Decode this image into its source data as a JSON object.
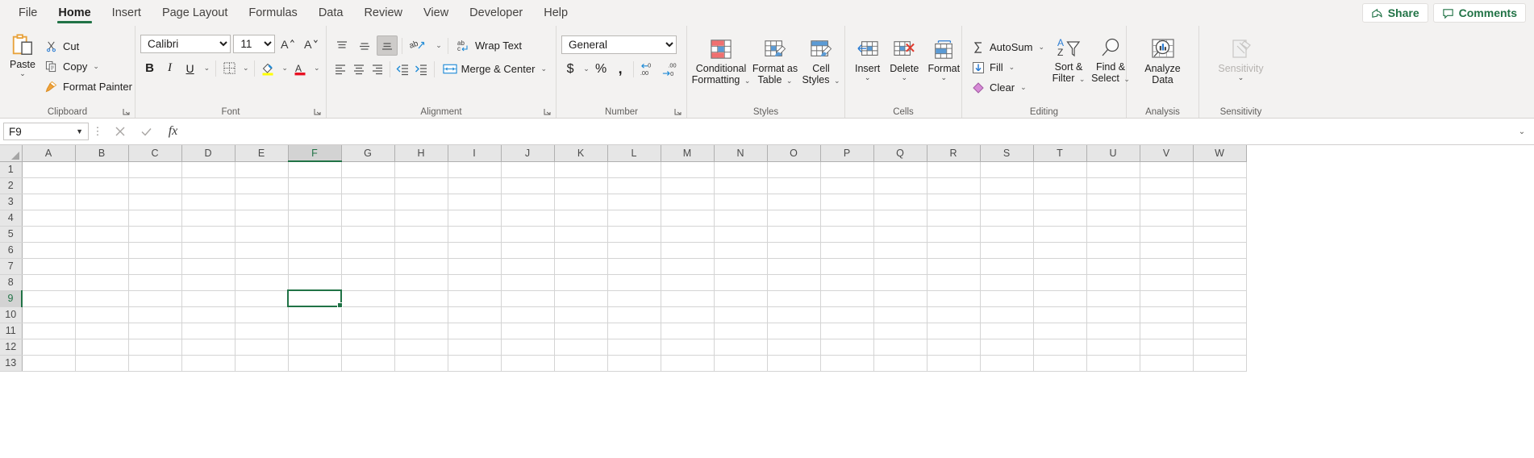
{
  "tabs": [
    {
      "label": "File",
      "active": false
    },
    {
      "label": "Home",
      "active": true
    },
    {
      "label": "Insert",
      "active": false
    },
    {
      "label": "Page Layout",
      "active": false
    },
    {
      "label": "Formulas",
      "active": false
    },
    {
      "label": "Data",
      "active": false
    },
    {
      "label": "Review",
      "active": false
    },
    {
      "label": "View",
      "active": false
    },
    {
      "label": "Developer",
      "active": false
    },
    {
      "label": "Help",
      "active": false
    }
  ],
  "titlebar": {
    "share_label": "Share",
    "comments_label": "Comments",
    "accent_color": "#217346"
  },
  "groups": {
    "clipboard": {
      "label": "Clipboard",
      "paste": "Paste",
      "cut": "Cut",
      "copy": "Copy",
      "format_painter": "Format Painter"
    },
    "font": {
      "label": "Font",
      "font_name": "Calibri",
      "font_size": "11",
      "grow_font": "A",
      "shrink_font": "A",
      "bold": "B",
      "italic": "I",
      "underline": "U",
      "borders": "borders",
      "fill_color": "fill",
      "font_color": "A"
    },
    "alignment": {
      "label": "Alignment",
      "align_top": "top-align",
      "align_middle": "middle-align",
      "align_bottom": "bottom-align",
      "orientation": "ab",
      "wrap_text": "Wrap Text",
      "align_left": "left-align",
      "align_center": "center-align",
      "align_right": "right-align",
      "decrease_indent": "decrease-indent",
      "increase_indent": "increase-indent",
      "merge_center": "Merge & Center"
    },
    "number": {
      "label": "Number",
      "format": "General",
      "currency": "$",
      "percent": "%",
      "comma": ",",
      "increase_decimal": ".00",
      "decrease_decimal": ".00"
    },
    "styles": {
      "label": "Styles",
      "conditional_formatting_l1": "Conditional",
      "conditional_formatting_l2": "Formatting",
      "format_as_table_l1": "Format as",
      "format_as_table_l2": "Table",
      "cell_styles_l1": "Cell",
      "cell_styles_l2": "Styles"
    },
    "cells": {
      "label": "Cells",
      "insert": "Insert",
      "delete": "Delete",
      "format": "Format"
    },
    "editing": {
      "label": "Editing",
      "autosum": "AutoSum",
      "fill": "Fill",
      "clear": "Clear",
      "sort_filter_l1": "Sort &",
      "sort_filter_l2": "Filter",
      "find_select_l1": "Find &",
      "find_select_l2": "Select"
    },
    "analysis": {
      "label": "Analysis",
      "analyze_data_l1": "Analyze",
      "analyze_data_l2": "Data"
    },
    "sensitivity": {
      "label": "Sensitivity",
      "sensitivity": "Sensitivity",
      "disabled": true
    }
  },
  "formula_bar": {
    "name_box_value": "F9",
    "formula_value": "",
    "cancel_icon": "cancel-icon",
    "enter_icon": "enter-icon",
    "fx_icon": "fx"
  },
  "sheet": {
    "columns": [
      "A",
      "B",
      "C",
      "D",
      "E",
      "F",
      "G",
      "H",
      "I",
      "J",
      "K",
      "L",
      "M",
      "N",
      "O",
      "P",
      "Q",
      "R",
      "S",
      "T",
      "U",
      "V",
      "W"
    ],
    "rows": [
      "1",
      "2",
      "3",
      "4",
      "5",
      "6",
      "7",
      "8",
      "9",
      "10",
      "11",
      "12",
      "13"
    ],
    "active_cell": "F9",
    "active_column": "F",
    "active_row": "9",
    "selection_color": "#217346"
  }
}
